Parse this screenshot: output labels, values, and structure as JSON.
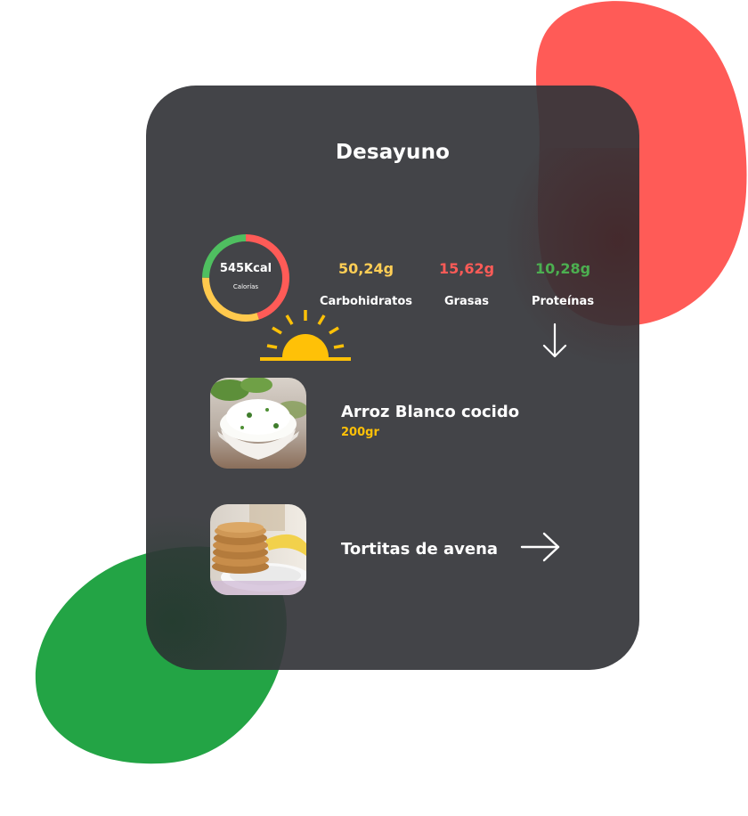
{
  "meal": {
    "title": "Desayuno",
    "calories_value": "545Kcal",
    "calories_label": "Calorías",
    "calorie_ring": [
      {
        "fraction": 0.45,
        "color": "#ff5b57"
      },
      {
        "fraction": 0.3,
        "color": "#ffc94d"
      },
      {
        "fraction": 0.25,
        "color": "#4fbf60"
      }
    ]
  },
  "macros": [
    {
      "value": "50,24g",
      "label": "Carbohidratos",
      "color": "#ffce55"
    },
    {
      "value": "15,62g",
      "label": "Grasas",
      "color": "#ff5b57"
    },
    {
      "value": "10,28g",
      "label": "Proteínas",
      "color": "#4caf50"
    }
  ],
  "foods": [
    {
      "name": "Arroz Blanco cocido",
      "amount": "200gr",
      "image": "rice-bowl-photo"
    },
    {
      "name": "Tortitas de avena",
      "image": "pancake-stack-photo"
    }
  ],
  "colors": {
    "card": "#35363a",
    "blob_red": "#ff5b57",
    "blob_green": "#23a445",
    "accent_yellow": "#ffc107"
  },
  "icons": {
    "sun": "sunrise-icon",
    "down": "arrow-down-icon",
    "right": "arrow-right-icon"
  }
}
